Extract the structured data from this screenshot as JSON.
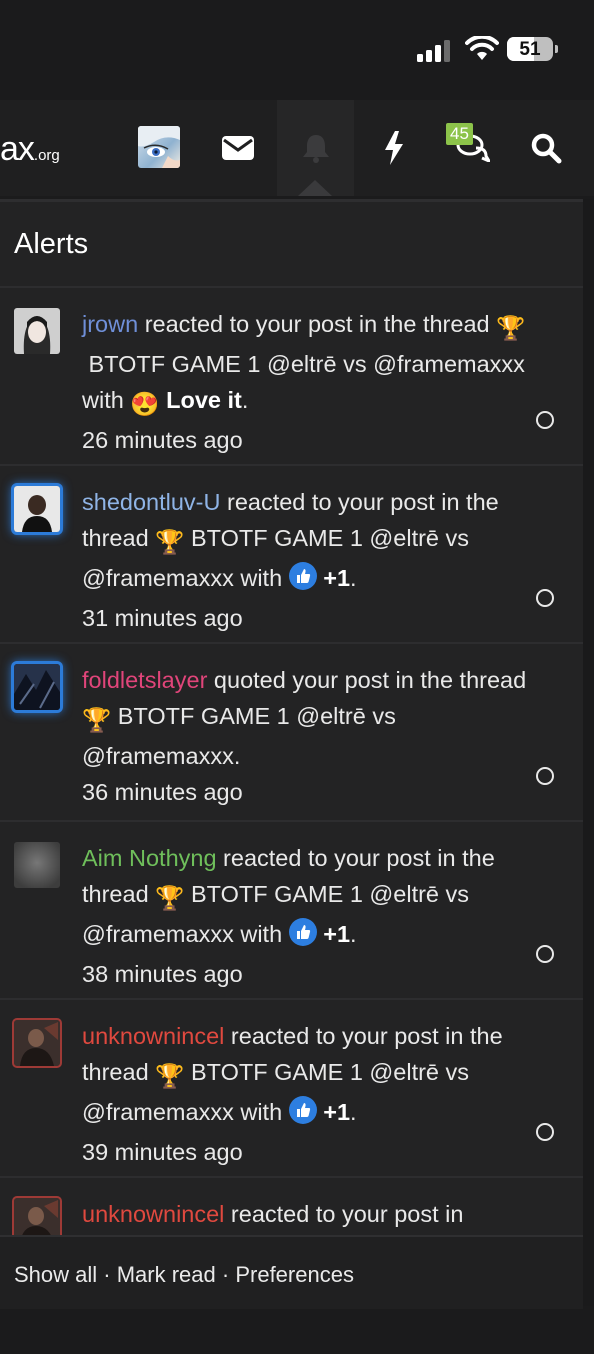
{
  "status": {
    "battery": "51",
    "battery_level": 0.51
  },
  "nav": {
    "logo_main": "ax",
    "logo_suffix": ".org",
    "conversations_badge": "45"
  },
  "panel": {
    "title": "Alerts"
  },
  "alerts": [
    {
      "user": "jrown",
      "before_reaction": " reacted to your post in the thread ",
      "thread": "BTOTF GAME 1 @eltrē vs @framemaxxx",
      "with": " with ",
      "reaction_icon": "heart-eyes-emoji",
      "reaction": "Love it",
      "end": ".",
      "time": "26 minutes ago"
    },
    {
      "user": "shedontluv-U",
      "before_reaction": " reacted to your post in the thread ",
      "thread": "BTOTF GAME 1 @eltrē vs @framemaxxx",
      "with": " with ",
      "reaction_icon": "thumbs-up-emoji",
      "reaction": "+1",
      "end": ".",
      "time": "31 minutes ago"
    },
    {
      "user": "foldletslayer",
      "before_reaction": " quoted your post in the thread ",
      "thread": "BTOTF GAME 1 @eltrē vs @framemaxxx",
      "end": ".",
      "time": "36 minutes ago"
    },
    {
      "user": "Aim Nothyng",
      "before_reaction": " reacted to your post in the thread ",
      "thread": "BTOTF GAME 1 @eltrē vs @framemaxxx",
      "with": " with ",
      "reaction_icon": "thumbs-up-emoji",
      "reaction": "+1",
      "end": ".",
      "time": "38 minutes ago"
    },
    {
      "user": "unknownincel",
      "before_reaction": " reacted to your post in the thread ",
      "thread": "BTOTF GAME 1 @eltrē vs @framemaxxx",
      "with": " with ",
      "reaction_icon": "thumbs-up-emoji",
      "reaction": "+1",
      "end": ".",
      "time": "39 minutes ago"
    },
    {
      "user": "unknownincel",
      "before_reaction": " reacted to your post in",
      "time": ""
    }
  ],
  "footer": {
    "show_all": "Show all",
    "sep1": " · ",
    "mark_read": "Mark read",
    "sep2": " · ",
    "preferences": "Preferences"
  },
  "colors": {
    "background": "#1b1b1c",
    "panel": "#232324",
    "badge": "#8cc34a",
    "highlight_ring": "#2c7bd8"
  }
}
